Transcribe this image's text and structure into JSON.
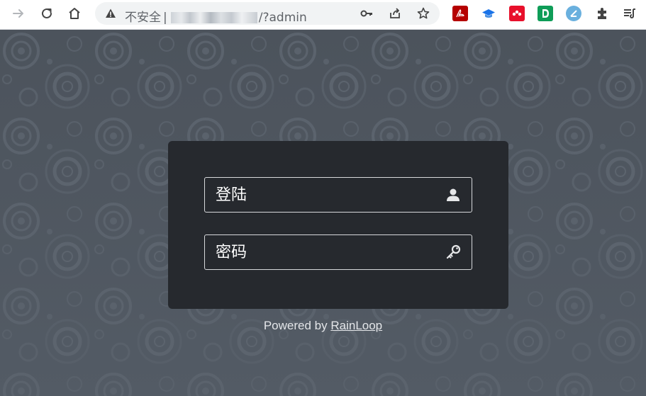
{
  "browser": {
    "address": {
      "security_label": "不安全",
      "separator": "|",
      "url_suffix": "/?admin"
    },
    "icons": {
      "back": "arrow-right-icon",
      "reload": "reload-icon",
      "home": "home-icon",
      "warning": "warning-icon",
      "key": "key-icon",
      "share": "share-icon",
      "bookmark": "star-icon",
      "extensions": [
        "pdf-extension-icon",
        "graduation-extension-icon",
        "mendeley-extension-icon",
        "d-extension-icon",
        "zotero-extension-icon",
        "puzzle-icon",
        "reading-list-icon"
      ]
    },
    "colors": {
      "pdf": "#c00000",
      "graduation": "#1a73e8",
      "mendeley": "#e8102b",
      "d_ext": "#0f9d58",
      "zotero": "#6ab0de"
    }
  },
  "login": {
    "username_placeholder": "登陆",
    "password_placeholder": "密码",
    "username_icon": "user-icon",
    "password_icon": "key-icon"
  },
  "footer": {
    "powered_prefix": "Powered by",
    "brand_link": "RainLoop"
  },
  "colors": {
    "background": "#4e5660",
    "card": "#26292e",
    "field_border": "#d7d9dc"
  }
}
